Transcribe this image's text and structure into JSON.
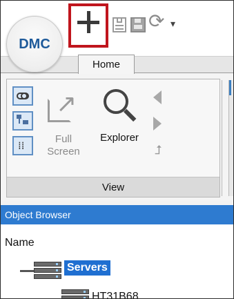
{
  "app": {
    "logo_text": "DMC"
  },
  "quick_access": {
    "new_icon": "plus-icon",
    "save_icon": "save-icon",
    "save_all_icon": "save-all-icon",
    "refresh_icon": "refresh-icon",
    "customize_icon": "dropdown-arrow-icon",
    "refresh_glyph": "⟳",
    "dropdown_glyph": "▾",
    "highlight_color": "#c0151d"
  },
  "tabs": [
    {
      "label": "Home",
      "active": true
    }
  ],
  "ribbon": {
    "group_label": "View",
    "full_screen_label": "Full Screen",
    "explorer_label": "Explorer",
    "up_glyph": "⮥"
  },
  "object_browser": {
    "title": "Object Browser",
    "column_header": "Name",
    "header_color": "#2e7bd0",
    "items": [
      {
        "label": "Servers",
        "selected": true
      },
      {
        "label": "HT31B68",
        "selected": false
      }
    ]
  }
}
